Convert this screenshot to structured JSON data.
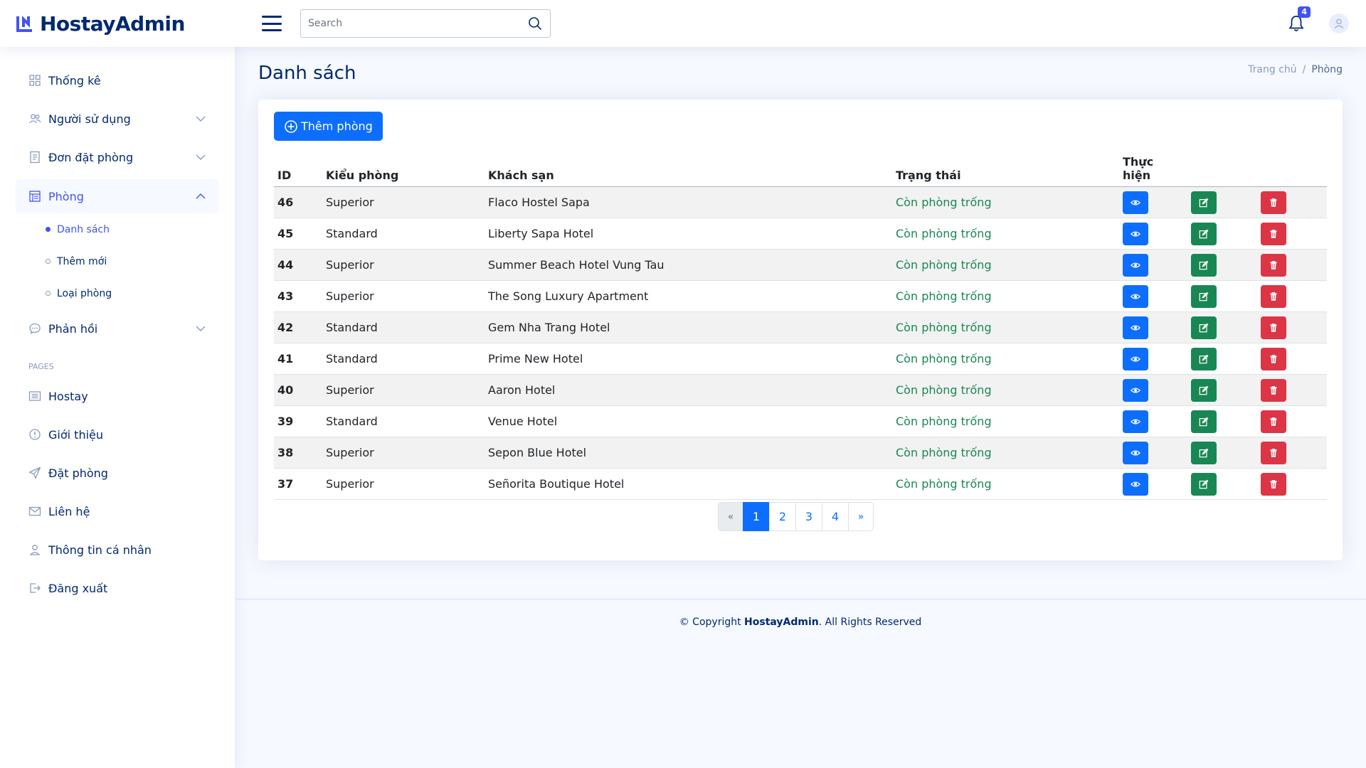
{
  "app": {
    "name": "HostayAdmin"
  },
  "header": {
    "search_placeholder": "Search",
    "notification_count": "4"
  },
  "sidebar": {
    "items": [
      {
        "label": "Thống kê"
      },
      {
        "label": "Người sử dụng"
      },
      {
        "label": "Đơn đặt phòng"
      },
      {
        "label": "Phòng"
      },
      {
        "label": "Phản hồi"
      }
    ],
    "sub_items": [
      {
        "label": "Danh sách"
      },
      {
        "label": "Thêm mới"
      },
      {
        "label": "Loại phòng"
      }
    ],
    "heading": "PAGES",
    "pages": [
      {
        "label": "Hostay"
      },
      {
        "label": "Giới thiệu"
      },
      {
        "label": "Đặt phòng"
      },
      {
        "label": "Liên hệ"
      },
      {
        "label": "Thông tin cá nhân"
      },
      {
        "label": "Đăng xuất"
      }
    ]
  },
  "main": {
    "title": "Danh sách",
    "breadcrumb": {
      "home": "Trang chủ",
      "separator": "/",
      "current": "Phòng"
    },
    "add_button": "Thêm phòng",
    "columns": [
      "ID",
      "Kiểu phòng",
      "Khách sạn",
      "Trạng thái",
      "Thực hiện"
    ],
    "rows": [
      {
        "id": "46",
        "type": "Superior",
        "hotel": "Flaco Hostel Sapa",
        "status": "Còn phòng trống"
      },
      {
        "id": "45",
        "type": "Standard",
        "hotel": "Liberty Sapa Hotel",
        "status": "Còn phòng trống"
      },
      {
        "id": "44",
        "type": "Superior",
        "hotel": "Summer Beach Hotel Vung Tau",
        "status": "Còn phòng trống"
      },
      {
        "id": "43",
        "type": "Superior",
        "hotel": "The Song Luxury Apartment",
        "status": "Còn phòng trống"
      },
      {
        "id": "42",
        "type": "Standard",
        "hotel": "Gem Nha Trang Hotel",
        "status": "Còn phòng trống"
      },
      {
        "id": "41",
        "type": "Standard",
        "hotel": "Prime New Hotel",
        "status": "Còn phòng trống"
      },
      {
        "id": "40",
        "type": "Superior",
        "hotel": "Aaron Hotel",
        "status": "Còn phòng trống"
      },
      {
        "id": "39",
        "type": "Standard",
        "hotel": "Venue Hotel",
        "status": "Còn phòng trống"
      },
      {
        "id": "38",
        "type": "Superior",
        "hotel": "Sepon Blue Hotel",
        "status": "Còn phòng trống"
      },
      {
        "id": "37",
        "type": "Superior",
        "hotel": "Señorita Boutique Hotel",
        "status": "Còn phòng trống"
      }
    ],
    "pagination": {
      "prev": "«",
      "pages": [
        "1",
        "2",
        "3",
        "4"
      ],
      "next": "»",
      "active": "1"
    }
  },
  "footer": {
    "prefix": "© Copyright ",
    "brand": "HostayAdmin",
    "suffix": ". All Rights Reserved"
  },
  "colors": {
    "primary": "#0d6efd",
    "success": "#198754",
    "danger": "#dc3545",
    "navy": "#012970",
    "accent": "#4154f1"
  },
  "icons": {
    "logo": "logo-mark-icon",
    "menu": "hamburger-icon",
    "search": "search-icon",
    "bell": "bell-icon",
    "avatar": "user-avatar-icon",
    "view": "eye-icon",
    "edit": "edit-icon",
    "delete": "trash-icon"
  }
}
